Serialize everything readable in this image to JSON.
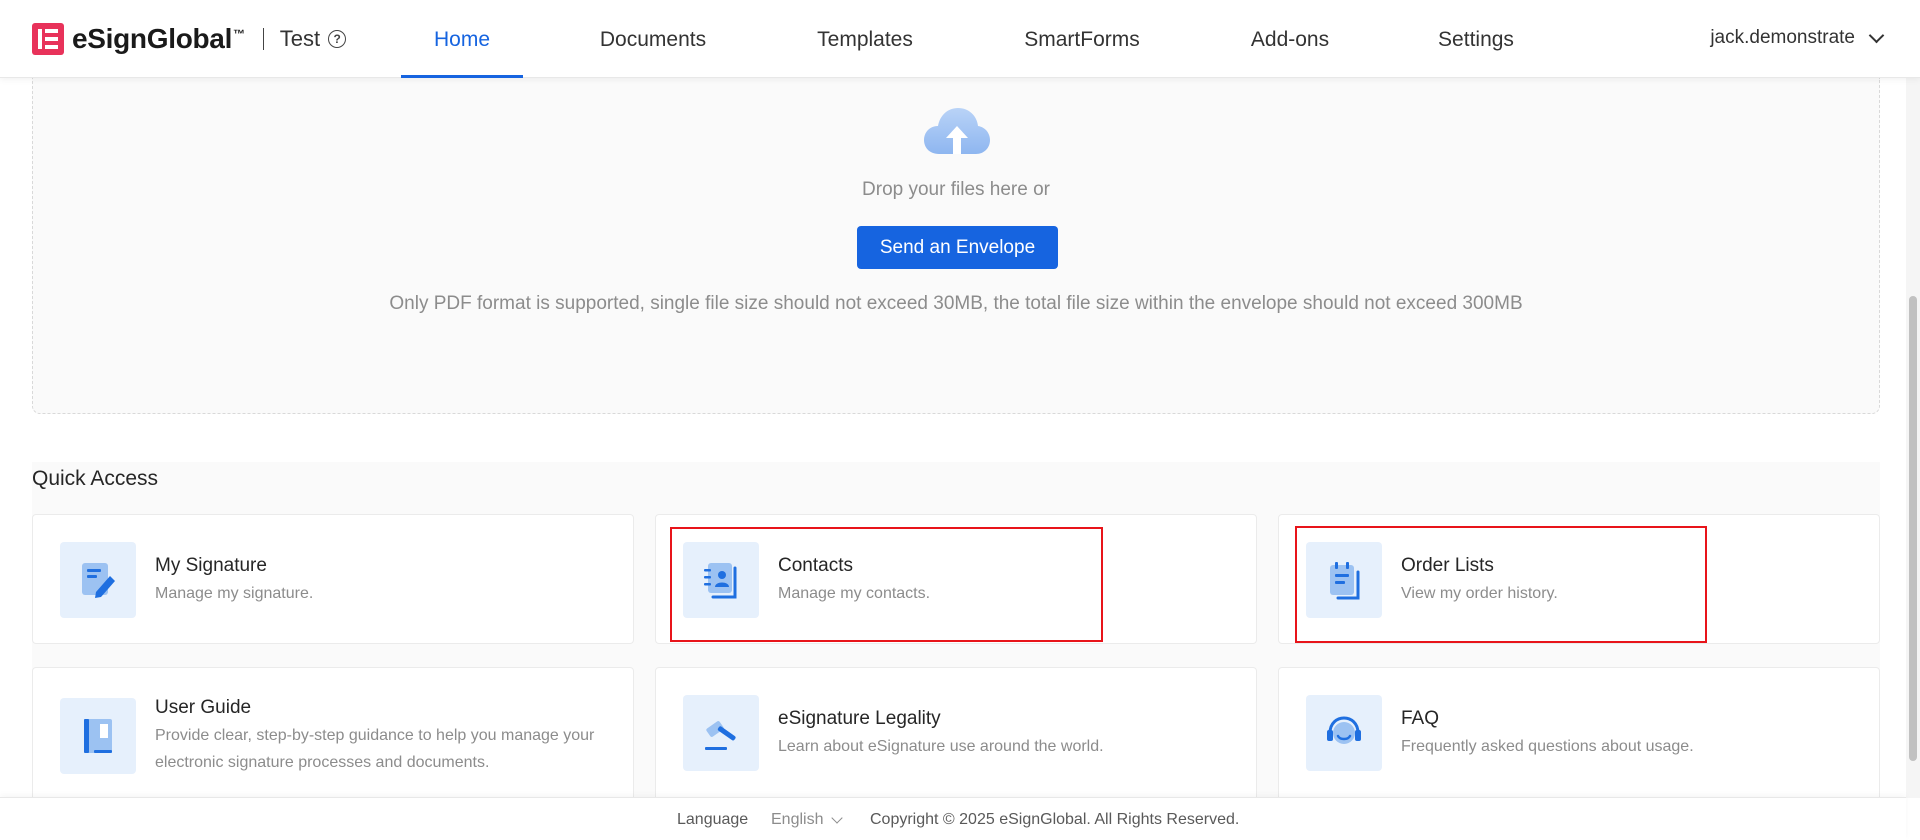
{
  "header": {
    "logo_text": "eSignGlobal",
    "logo_tm": "™",
    "org_name": "Test",
    "nav": [
      {
        "label": "Home",
        "active": true
      },
      {
        "label": "Documents",
        "active": false
      },
      {
        "label": "Templates",
        "active": false
      },
      {
        "label": "SmartForms",
        "active": false
      },
      {
        "label": "Add-ons",
        "active": false
      },
      {
        "label": "Settings",
        "active": false
      }
    ],
    "user": "jack.demonstrate"
  },
  "upload": {
    "drop_text": "Drop your files here or",
    "send_button": "Send an Envelope",
    "hint": "Only PDF format is supported, single file size should not exceed 30MB, the total file size within the envelope should not exceed 300MB"
  },
  "quick_access": {
    "title": "Quick Access",
    "cards": [
      {
        "title": "My Signature",
        "desc": "Manage my signature.",
        "icon": "signature-icon"
      },
      {
        "title": "Contacts",
        "desc": "Manage my contacts.",
        "icon": "contacts-icon"
      },
      {
        "title": "Order Lists",
        "desc": "View my order history.",
        "icon": "order-list-icon"
      },
      {
        "title": "User Guide",
        "desc": "Provide clear, step-by-step guidance to help you manage your electronic signature processes and documents.",
        "icon": "book-icon"
      },
      {
        "title": "eSignature Legality",
        "desc": "Learn about eSignature use around the world.",
        "icon": "gavel-icon"
      },
      {
        "title": "FAQ",
        "desc": "Frequently asked questions about usage.",
        "icon": "headset-icon"
      }
    ]
  },
  "footer": {
    "language_label": "Language",
    "language_value": "English",
    "copyright": "Copyright © 2025 eSignGlobal. All Rights Reserved."
  },
  "colors": {
    "primary": "#1664e0",
    "brand": "#e8325a",
    "icon_bg": "#e6f0fc",
    "highlight": "#e8141a"
  }
}
